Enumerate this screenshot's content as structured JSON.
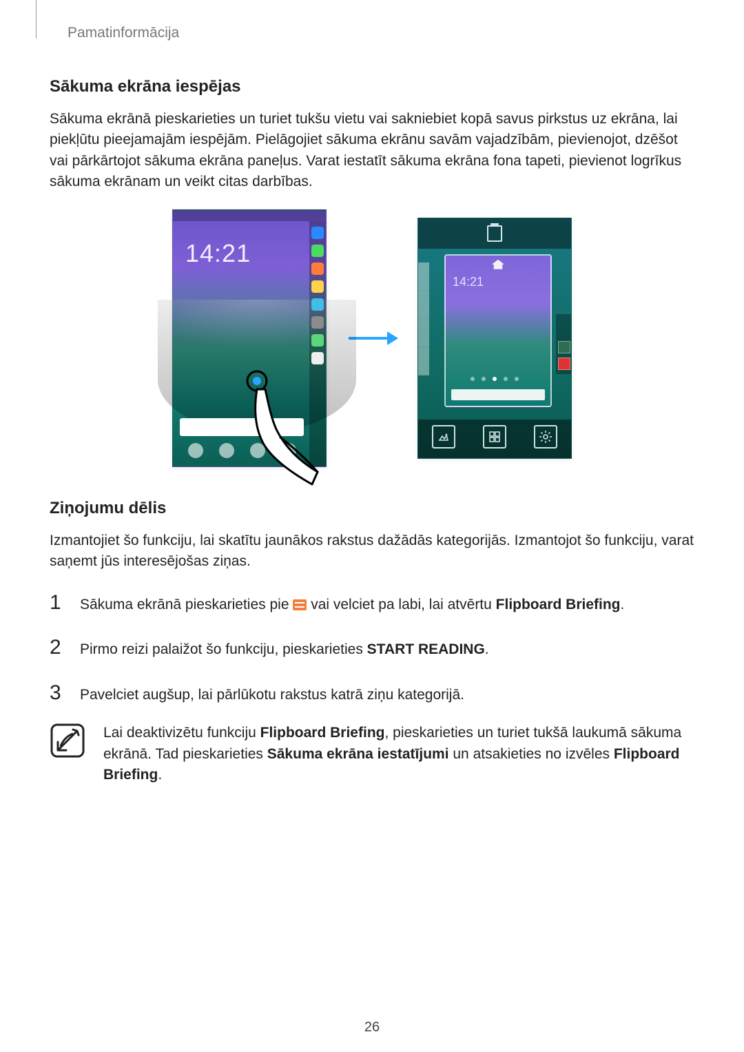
{
  "header": {
    "breadcrumb": "Pamatinformācija"
  },
  "section1": {
    "heading": "Sākuma ekrāna iespējas",
    "body": "Sākuma ekrānā pieskarieties un turiet tukšu vietu vai saknie­biet kopā savus pirkstus uz ekrāna, lai piekļūtu pieejamajām iespējām. Pielāgojiet sākuma ekrānu savām vajadzībām, pievienojot, dzēšot vai pārkārtojot sākuma ekrāna paneļus. Varat iestatīt sākuma ekrāna fona tapeti, pievienot logrīkus sākuma ekrānam un veikt citas darbības.",
    "clock_left": "14:21",
    "clock_right": "14:21"
  },
  "section2": {
    "heading": "Ziņojumu dēlis",
    "body": "Izmantojiet šo funkciju, lai skatītu jaunākos rakstus dažādās kategorijās. Izmantojot šo funkciju, varat saņemt jūs interesējošas ziņas.",
    "steps": {
      "s1_a": "Sākuma ekrānā pieskarieties pie ",
      "s1_b": " vai velciet pa labi, lai atvērtu ",
      "s1_bold": "Flipboard Briefing",
      "s1_c": ".",
      "s2_a": "Pirmo reizi palaižot šo funkciju, pieskarieties ",
      "s2_bold": "START READING",
      "s2_b": ".",
      "s3": "Pavelciet augšup, lai pārlūkotu rakstus katrā ziņu kategorijā."
    },
    "note_a": "Lai deaktivizētu funkciju ",
    "note_bold1": "Flipboard Briefing",
    "note_b": ", pieskarieties un turiet tukšā laukumā sākuma ekrānā. Tad pieskarieties ",
    "note_bold2": "Sākuma ekrāna iestatījumi",
    "note_c": " un atsakieties no izvēles ",
    "note_bold3": "Flipboard Briefing",
    "note_d": "."
  },
  "page_number": "26",
  "step_numbers": {
    "n1": "1",
    "n2": "2",
    "n3": "3"
  }
}
